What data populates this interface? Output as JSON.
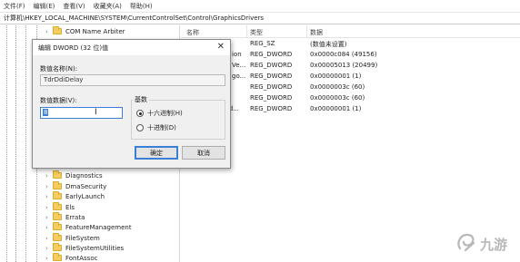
{
  "menubar": {
    "items": [
      "文件(F)",
      "编辑(E)",
      "查看(V)",
      "收藏夹(A)",
      "帮助(H)"
    ]
  },
  "address": {
    "path": "计算机\\HKEY_LOCAL_MACHINE\\SYSTEM\\CurrentControlSet\\Control\\GraphicsDrivers"
  },
  "tree": {
    "items": [
      "COM Name Arbiter",
      "Diagnostics",
      "DmaSecurity",
      "EarlyLaunch",
      "Els",
      "Errata",
      "FeatureManagement",
      "FileSystem",
      "FileSystemUtilities",
      "FontAssoc"
    ]
  },
  "list": {
    "headers": {
      "name": "名称",
      "type": "类型",
      "data": "数据"
    },
    "rows": [
      {
        "name": "",
        "type": "REG_SZ",
        "data": "(数值未设置)"
      },
      {
        "name": "ion",
        "type": "REG_DWORD",
        "data": "0x0000c084 (49156)"
      },
      {
        "name": "Ve...",
        "type": "REG_DWORD",
        "data": "0x00005013 (20499)"
      },
      {
        "name": "go...",
        "type": "REG_DWORD",
        "data": "0x00000001 (1)"
      },
      {
        "name": "",
        "type": "REG_DWORD",
        "data": "0x0000003c (60)"
      },
      {
        "name": "",
        "type": "REG_DWORD",
        "data": "0x0000003c (60)"
      },
      {
        "name": "rd...",
        "type": "REG_DWORD",
        "data": "0x00000001 (1)"
      }
    ]
  },
  "dialog": {
    "title": "编辑 DWORD (32 位)值",
    "close": "✕",
    "name_label": "数值名称(N):",
    "name_value": "TdrDdiDelay",
    "value_label": "数值数据(V):",
    "value_text": "8",
    "base_label": "基数",
    "hex_label": "十六进制(H)",
    "dec_label": "十进制(D)",
    "ok": "确定",
    "cancel": "取消"
  },
  "watermark": {
    "text": "九游"
  }
}
